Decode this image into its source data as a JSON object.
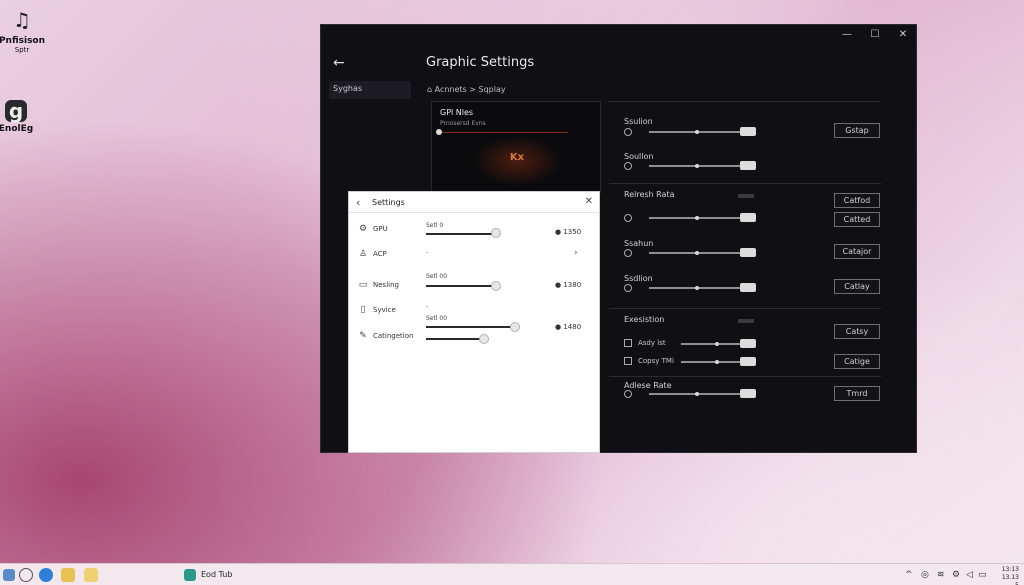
{
  "desktop": {
    "icons": [
      {
        "glyph": "♫",
        "label1": "Pnfisison",
        "label2": "Sptr",
        "icon": "music-file-icon"
      },
      {
        "glyph": "g",
        "label1": "EnolEg",
        "label2": "",
        "icon": "app-icon"
      }
    ]
  },
  "dark_window": {
    "title": "Graphic Settings",
    "back_icon": "←",
    "controls": {
      "minimize": "—",
      "maximize": "☐",
      "close": "✕"
    },
    "sidebar_item": "Syghas",
    "breadcrumb": "Acnnets  >  Sqplay",
    "preview": {
      "title": "GPl Nles",
      "subtitle": "Prnosersd Evns",
      "logo": "Kx"
    },
    "rows": [
      {
        "label": "Ssulion",
        "button": "Gstap"
      },
      {
        "label": "Soullon",
        "button": ""
      },
      {
        "label": "Relresh Rata",
        "button": "Catfod"
      },
      {
        "label": "",
        "button": "Catted"
      },
      {
        "label": "Ssahun",
        "button": "Catajor"
      },
      {
        "label": "Ssdlion",
        "button": "Catlay"
      },
      {
        "label": "Exesistion",
        "button": "Catsy"
      },
      {
        "label": "Asdy lst",
        "button": ""
      },
      {
        "label": "Copsy TMi",
        "button": "Catige"
      },
      {
        "label": "Adlese Rate",
        "button": "Tmrd"
      }
    ]
  },
  "settings_dialog": {
    "title": "Settings",
    "back_icon": "‹",
    "close_icon": "✕",
    "items": [
      {
        "label": "GPU",
        "icon": "⚙",
        "sub": "Setl 0",
        "value": "1350"
      },
      {
        "label": "ACP",
        "icon": "♙",
        "sub": "-",
        "value": "›"
      },
      {
        "label": "Nesling",
        "icon": "▭",
        "sub": "Setl 00",
        "value": "1380"
      },
      {
        "label": "Syvice",
        "icon": "▯",
        "sub": "-",
        "value": ""
      },
      {
        "label": "Catingetion",
        "icon": "✎",
        "sub": "Setl 00",
        "value": "1480"
      }
    ]
  },
  "taskbar": {
    "app_label": "Eod Tub",
    "time": "13:13",
    "date": "13.13 5"
  }
}
